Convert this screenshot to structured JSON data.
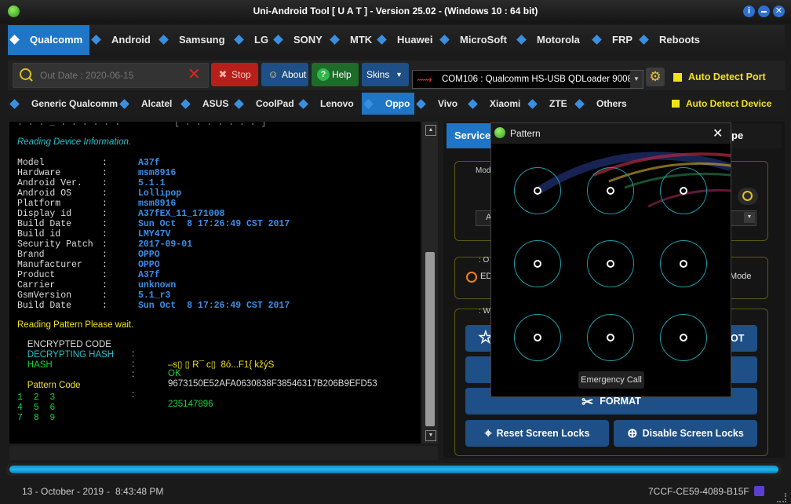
{
  "window": {
    "title": "Uni-Android Tool [ U A T ] - Version 25.02  -  (Windows 10  : 64 bit)"
  },
  "brand_tabs": [
    "Qualcomm",
    "Android",
    "Samsung",
    "LG",
    "SONY",
    "MTK",
    "Huawei",
    "MicroSoft",
    "Motorola",
    "FRP",
    "Reboots"
  ],
  "toolbar": {
    "search_placeholder": "Out Date : 2020-06-15",
    "stop_label": "Stop",
    "about_label": "About",
    "help_label": "Help",
    "skins_label": "Skins",
    "port_value": "COM106 : Qualcomm HS-USB QDLoader 9008 (CO",
    "auto_detect_port": "Auto Detect Port"
  },
  "device_tabs": [
    "Generic Qualcomm",
    "Alcatel",
    "ASUS",
    "CoolPad",
    "Lenovo",
    "Oppo",
    "Vivo",
    "Xiaomi",
    "ZTE",
    "Others"
  ],
  "auto_detect_device": "Auto Detect Device",
  "log": {
    "reading_info": "Reading Device Information.",
    "fields": [
      {
        "k": "Model",
        "v": "A37f"
      },
      {
        "k": "Hardware",
        "v": "msm8916"
      },
      {
        "k": "Android Ver.",
        "v": "5.1.1"
      },
      {
        "k": "Android OS",
        "v": "Lollipop"
      },
      {
        "k": "Platform",
        "v": "msm8916"
      },
      {
        "k": "Display id",
        "v": "A37fEX_11_171008"
      },
      {
        "k": "Build Date",
        "v": "Sun Oct  8 17:26:49 CST 2017"
      },
      {
        "k": "Build id",
        "v": "LMY47V"
      },
      {
        "k": "Security Patch",
        "v": "2017-09-01"
      },
      {
        "k": "Brand",
        "v": "OPPO"
      },
      {
        "k": "Manufacturer",
        "v": "OPPO"
      },
      {
        "k": "Product",
        "v": "A37f"
      },
      {
        "k": "Carrier",
        "v": "unknown"
      },
      {
        "k": "GsmVersion",
        "v": "5.1_r3"
      },
      {
        "k": "Build Date",
        "v": "Sun Oct  8 17:26:49 CST 2017"
      }
    ],
    "reading_pattern": "Reading Pattern Please wait.",
    "encrypted_label": "ENCRYPTED CODE",
    "encrypted_value": "–s▯ ▯ R¯ c▯  8ó...F1{ kžýS",
    "decrypting_label": "DECRYPTING HASH",
    "decrypting_value": "OK",
    "hash_label": "HASH",
    "hash_value": "9673150E52AFA0630838F38546317B206B9EFD53",
    "pattern_label": "Pattern Code",
    "pattern_value": "235147896",
    "grid_rows": [
      "1  2  3",
      "4  5  6",
      "7  8  9"
    ]
  },
  "right_panel": {
    "tab_service": "Service",
    "tab_partial": "pe",
    "group1_label": "Mod",
    "group2_label": ": O",
    "option_partial": "ED",
    "mode_label": "Mode",
    "group3_label": ": W",
    "ot_partial": "OT",
    "format_label": "FORMAT",
    "reset_label": "Reset Screen Locks",
    "disable_label": "Disable Screen Locks",
    "combo_partial": "A"
  },
  "pattern_dialog": {
    "title": "Pattern",
    "emergency_label": "Emergency Call"
  },
  "status": {
    "date": "13 - October - 2019",
    "time": "8:43:48 PM",
    "id": "7CCF-CE59-4089-B15F"
  },
  "colors": {
    "accent": "#1f76c7",
    "value_blue": "#3a8fe8",
    "yellow": "#f2e21a",
    "cyan": "#27c1c9",
    "green": "#19d23a"
  }
}
